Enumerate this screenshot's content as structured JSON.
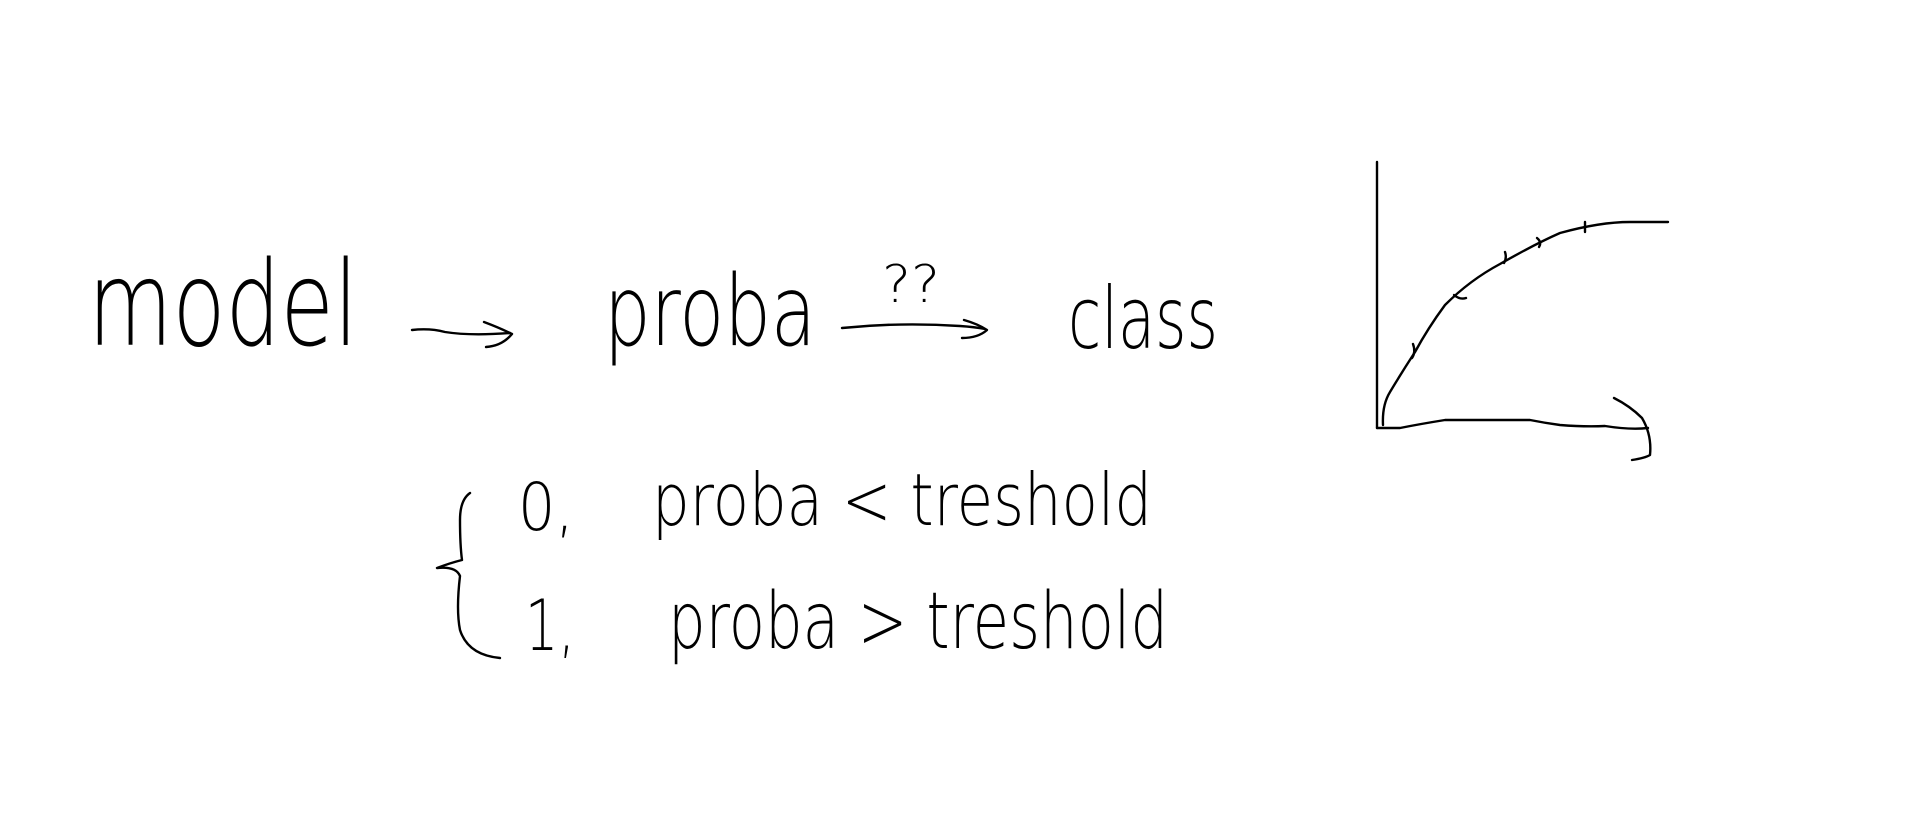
{
  "diagram": {
    "top_row": {
      "model_label": "model",
      "proba_label": "proba",
      "question_label": "??",
      "class_label": "class"
    },
    "cases": [
      {
        "value": "0,",
        "condition": "proba < treshold"
      },
      {
        "value": "1,",
        "condition": "proba > treshold"
      }
    ],
    "sketch_curve": {
      "shape": "concave increasing curve on axes",
      "axis_labels": []
    }
  },
  "colors": {
    "ink": "#000000",
    "background": "#ffffff"
  }
}
